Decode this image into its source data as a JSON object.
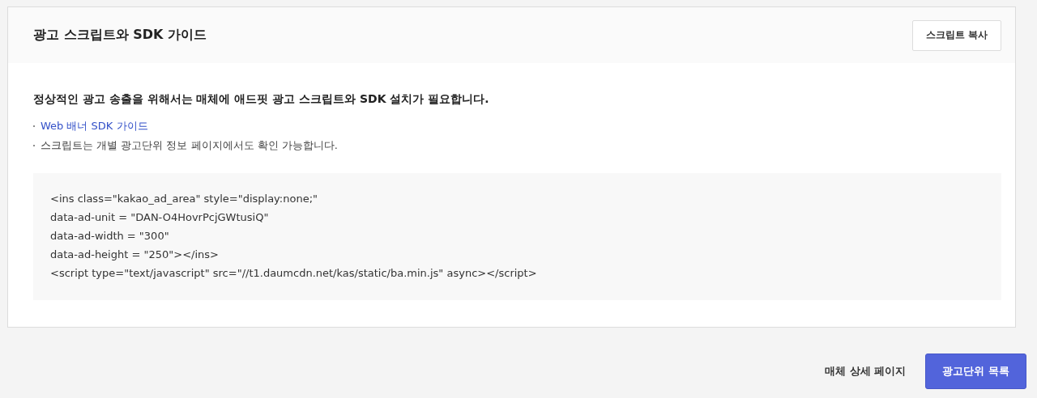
{
  "panel": {
    "title": "광고 스크립트와 SDK 가이드",
    "copy_button": "스크립트 복사"
  },
  "notice": "정상적인 광고 송출을 위해서는 매체에 애드핏 광고 스크립트와 SDK 설치가 필요합니다.",
  "bullets": [
    {
      "kind": "link",
      "text": "Web 배너 SDK 가이드"
    },
    {
      "kind": "text",
      "text": "스크립트는 개별 광고단위 정보 페이지에서도 확인 가능합니다."
    }
  ],
  "code_lines": [
    "<ins class=\"kakao_ad_area\" style=\"display:none;\"",
    "data-ad-unit = \"DAN-O4HovrPcjGWtusiQ\"",
    "data-ad-width = \"300\"",
    "data-ad-height = \"250\"></ins>",
    "<script type=\"text/javascript\" src=\"//t1.daumcdn.net/kas/static/ba.min.js\" async></script>"
  ],
  "footer_buttons": [
    {
      "kind": "secondary",
      "label": "매체 상세 페이지"
    },
    {
      "kind": "primary",
      "label": "광고단위 목록"
    }
  ]
}
